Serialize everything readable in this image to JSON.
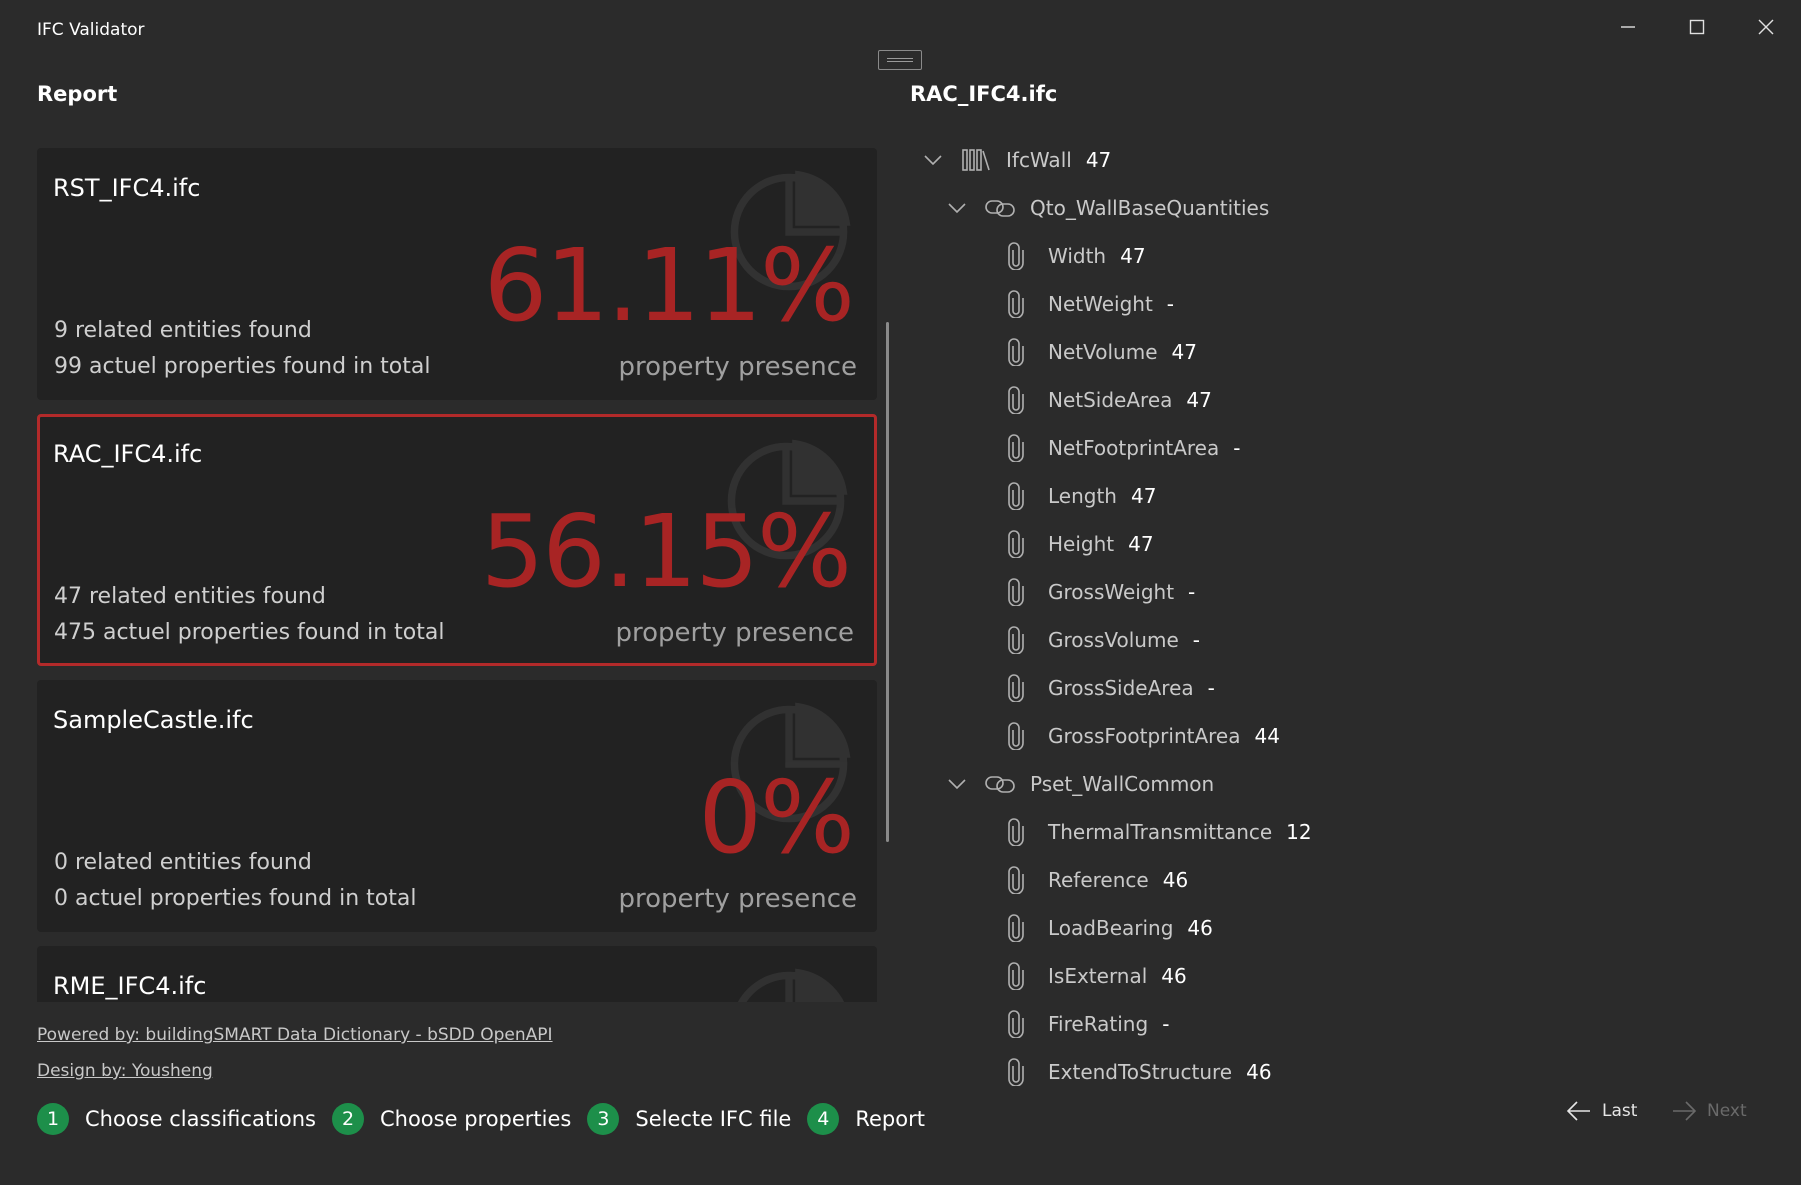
{
  "window": {
    "title": "IFC Validator",
    "controls": [
      "minimize-icon",
      "maximize-icon",
      "close-icon"
    ]
  },
  "left_panel": {
    "title": "Report",
    "cards": [
      {
        "name": "RST_IFC4.ifc",
        "percentage": "61.11%",
        "entities": "9 related entities found",
        "properties": "99 actuel properties found in total",
        "caption": "property presence",
        "selected": false
      },
      {
        "name": "RAC_IFC4.ifc",
        "percentage": "56.15%",
        "entities": "47 related entities found",
        "properties": "475 actuel properties found in total",
        "caption": "property presence",
        "selected": true
      },
      {
        "name": "SampleCastle.ifc",
        "percentage": "0%",
        "entities": "0 related entities found",
        "properties": "0 actuel properties found in total",
        "caption": "property presence",
        "selected": false
      },
      {
        "name": "RME_IFC4.ifc",
        "percentage": "",
        "entities": "",
        "properties": "",
        "caption": "",
        "selected": false
      }
    ],
    "links": {
      "powered": "Powered by: buildingSMART Data Dictionary - bSDD OpenAPI",
      "design": "Design by: Yousheng"
    }
  },
  "steps": [
    {
      "num": "1",
      "label": "Choose classifications"
    },
    {
      "num": "2",
      "label": "Choose properties"
    },
    {
      "num": "3",
      "label": "Selecte IFC file"
    },
    {
      "num": "4",
      "label": "Report"
    }
  ],
  "right_panel": {
    "title": "RAC_IFC4.ifc",
    "tree": [
      {
        "level": 0,
        "type": "entity",
        "label": "IfcWall",
        "count": "47",
        "expanded": true
      },
      {
        "level": 1,
        "type": "pset",
        "label": "Qto_WallBaseQuantities",
        "count": "",
        "expanded": true
      },
      {
        "level": 2,
        "type": "prop",
        "label": "Width",
        "count": "47"
      },
      {
        "level": 2,
        "type": "prop",
        "label": "NetWeight",
        "count": "-"
      },
      {
        "level": 2,
        "type": "prop",
        "label": "NetVolume",
        "count": "47"
      },
      {
        "level": 2,
        "type": "prop",
        "label": "NetSideArea",
        "count": "47"
      },
      {
        "level": 2,
        "type": "prop",
        "label": "NetFootprintArea",
        "count": "-"
      },
      {
        "level": 2,
        "type": "prop",
        "label": "Length",
        "count": "47"
      },
      {
        "level": 2,
        "type": "prop",
        "label": "Height",
        "count": "47"
      },
      {
        "level": 2,
        "type": "prop",
        "label": "GrossWeight",
        "count": "-"
      },
      {
        "level": 2,
        "type": "prop",
        "label": "GrossVolume",
        "count": "-"
      },
      {
        "level": 2,
        "type": "prop",
        "label": "GrossSideArea",
        "count": "-"
      },
      {
        "level": 2,
        "type": "prop",
        "label": "GrossFootprintArea",
        "count": "44"
      },
      {
        "level": 1,
        "type": "pset",
        "label": "Pset_WallCommon",
        "count": "",
        "expanded": true
      },
      {
        "level": 2,
        "type": "prop",
        "label": "ThermalTransmittance",
        "count": "12"
      },
      {
        "level": 2,
        "type": "prop",
        "label": "Reference",
        "count": "46"
      },
      {
        "level": 2,
        "type": "prop",
        "label": "LoadBearing",
        "count": "46"
      },
      {
        "level": 2,
        "type": "prop",
        "label": "IsExternal",
        "count": "46"
      },
      {
        "level": 2,
        "type": "prop",
        "label": "FireRating",
        "count": "-"
      },
      {
        "level": 2,
        "type": "prop",
        "label": "ExtendToStructure",
        "count": "46"
      }
    ]
  },
  "navigation": {
    "last_label": "Last",
    "next_label": "Next",
    "next_enabled": false
  },
  "colors": {
    "background": "#2b2b2b",
    "card": "#222222",
    "accent_red": "#a82424",
    "step_green": "#1d8f4a"
  }
}
